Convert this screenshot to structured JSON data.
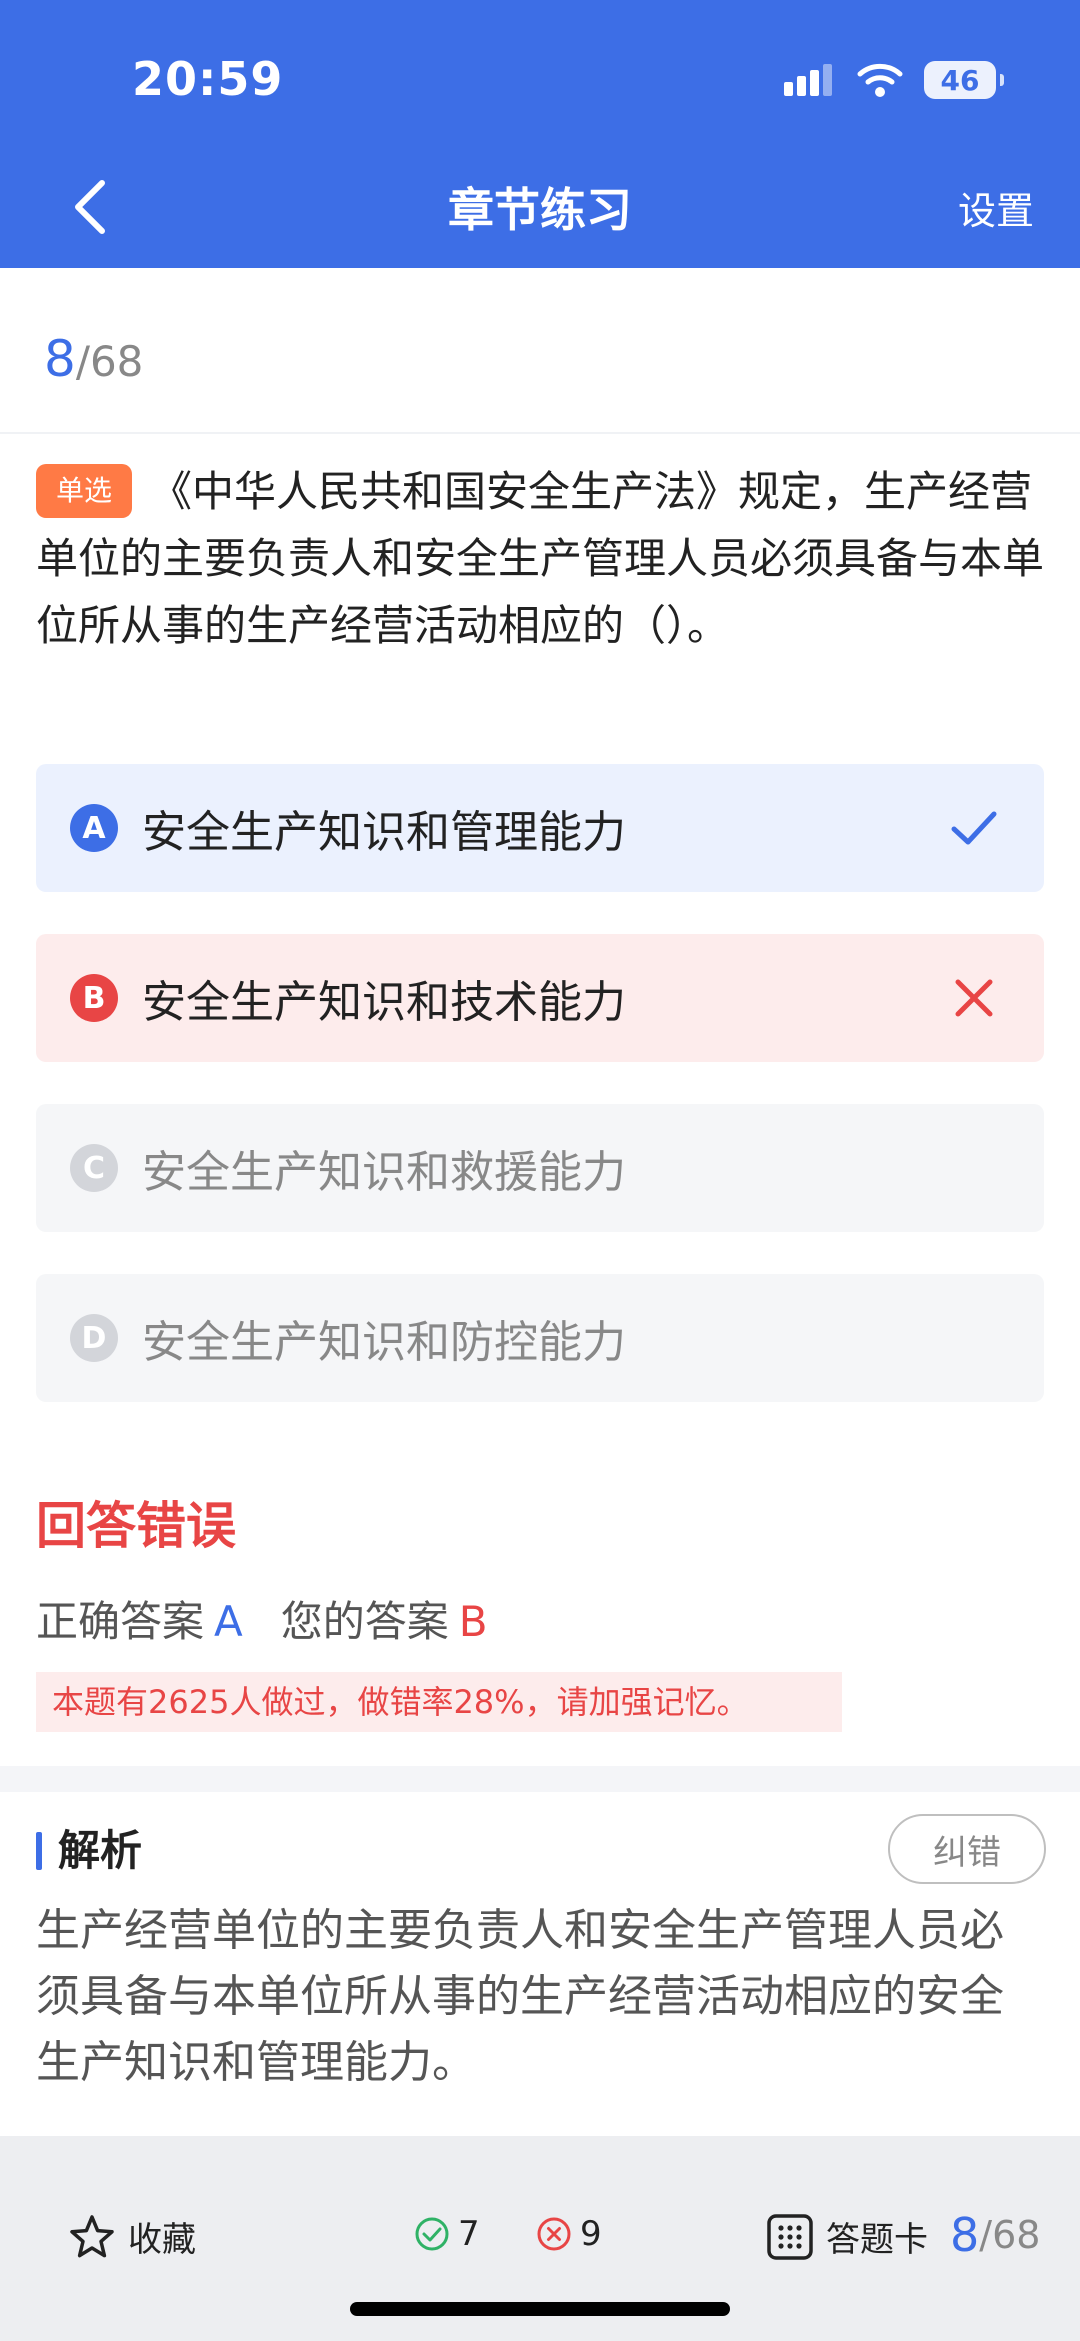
{
  "status": {
    "time": "20:59",
    "battery": "46"
  },
  "nav": {
    "title": "章节练习",
    "settings": "设置"
  },
  "progress": {
    "current": "8",
    "total": "/68"
  },
  "question": {
    "type_tag": "单选",
    "text": "《中华人民共和国安全生产法》规定，生产经营单位的主要负责人和安全生产管理人员必须具备与本单位所从事的生产经营活动相应的（）。"
  },
  "options": [
    {
      "letter": "A",
      "text": "安全生产知识和管理能力",
      "state": "correct"
    },
    {
      "letter": "B",
      "text": "安全生产知识和技术能力",
      "state": "wrong"
    },
    {
      "letter": "C",
      "text": "安全生产知识和救援能力",
      "state": "normal"
    },
    {
      "letter": "D",
      "text": "安全生产知识和防控能力",
      "state": "normal"
    }
  ],
  "result": {
    "title": "回答错误",
    "correct_label": "正确答案",
    "correct_value": "A",
    "yours_label": "您的答案",
    "yours_value": "B",
    "stat": "本题有2625人做过，做错率28%，请加强记忆。"
  },
  "analysis": {
    "title": "解析",
    "report_label": "纠错",
    "text": "生产经营单位的主要负责人和安全生产管理人员必须具备与本单位所从事的生产经营活动相应的安全生产知识和管理能力。"
  },
  "bottom": {
    "favorite": "收藏",
    "right_count": "7",
    "wrong_count": "9",
    "card": "答题卡",
    "current": "8",
    "total": "/68"
  },
  "colors": {
    "primary": "#3d6ee6",
    "error": "#e84545",
    "tag": "#ff7a45"
  },
  "icons": [
    "signal-icon",
    "wifi-icon",
    "battery-icon",
    "back-arrow-icon",
    "check-icon",
    "cross-icon",
    "star-icon",
    "check-circle-icon",
    "cross-circle-icon",
    "grid-icon"
  ]
}
